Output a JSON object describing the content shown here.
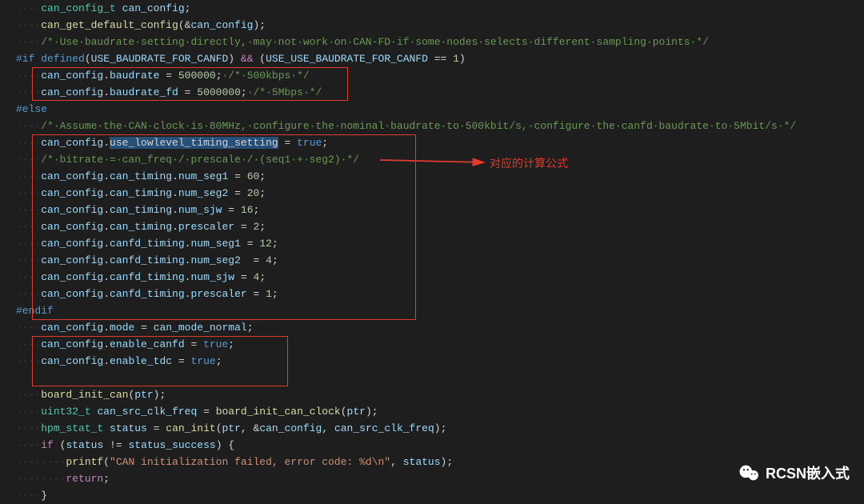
{
  "watermark": {
    "text": "RCSN嵌入式"
  },
  "annotation": {
    "label": "对应的计算公式"
  },
  "chart_data": {
    "type": "table",
    "title": "CAN config snippet (C source)",
    "rows": [
      [
        "can_config_t can_config;"
      ],
      [
        "can_get_default_config(&can_config);"
      ],
      [
        "/* Use baudrate setting directly, may not work on CAN-FD if some nodes selects different sampling points */"
      ],
      [
        "#if defined(USE_BAUDRATE_FOR_CANFD) && (USE_USE_BAUDRATE_FOR_CANFD == 1)"
      ],
      [
        "can_config.baudrate = 500000; /* 500kbps */"
      ],
      [
        "can_config.baudrate_fd = 5000000; /* 5Mbps */"
      ],
      [
        "#else"
      ],
      [
        "/* Assume the CAN clock is 80MHz, configure the nominal baudrate to 500kbit/s, configure the canfd baudrate to 5Mbit/s */"
      ],
      [
        "can_config.use_lowlevel_timing_setting = true;"
      ],
      [
        "/* bitrate = can_freq / prescale / (seq1 + seg2) */"
      ],
      [
        "can_config.can_timing.num_seg1 = 60;"
      ],
      [
        "can_config.can_timing.num_seg2 = 20;"
      ],
      [
        "can_config.can_timing.num_sjw = 16;"
      ],
      [
        "can_config.can_timing.prescaler = 2;"
      ],
      [
        "can_config.canfd_timing.num_seg1 = 12;"
      ],
      [
        "can_config.canfd_timing.num_seg2  = 4;"
      ],
      [
        "can_config.canfd_timing.num_sjw = 4;"
      ],
      [
        "can_config.canfd_timing.prescaler = 1;"
      ],
      [
        "#endif"
      ],
      [
        "can_config.mode = can_mode_normal;"
      ],
      [
        "can_config.enable_canfd = true;"
      ],
      [
        "can_config.enable_tdc = true;"
      ],
      [
        ""
      ],
      [
        "board_init_can(ptr);"
      ],
      [
        "uint32_t can_src_clk_freq = board_init_can_clock(ptr);"
      ],
      [
        "hpm_stat_t status = can_init(ptr, &can_config, can_src_clk_freq);"
      ],
      [
        "if (status != status_success) {"
      ],
      [
        "    printf(\"CAN initialization failed, error code: %d\\n\", status);"
      ],
      [
        "    return;"
      ],
      [
        "}"
      ]
    ]
  },
  "tokens": {
    "l0": [
      [
        "ws",
        "····"
      ],
      [
        "ty",
        "can_config_t"
      ],
      [
        "op",
        " "
      ],
      [
        "id",
        "can_config"
      ],
      [
        "op",
        ";"
      ]
    ],
    "l1": [
      [
        "ws",
        "····"
      ],
      [
        "fn",
        "can_get_default_config"
      ],
      [
        "op",
        "(&"
      ],
      [
        "id",
        "can_config"
      ],
      [
        "op",
        ");"
      ]
    ],
    "l2": [
      [
        "ws",
        "····"
      ],
      [
        "cm",
        "/*·Use·baudrate·setting·directly,·may·not·work·on·CAN-FD·if·some·nodes·selects·different·sampling·points·*/"
      ]
    ],
    "l3": [
      [
        "macro",
        "#if"
      ],
      [
        "op",
        " "
      ],
      [
        "macro",
        "defined"
      ],
      [
        "op",
        "("
      ],
      [
        "id",
        "USE_BAUDRATE_FOR_CANFD"
      ],
      [
        "op",
        ") "
      ],
      [
        "kw",
        "&&"
      ],
      [
        "op",
        " ("
      ],
      [
        "id",
        "USE_USE_BAUDRATE_FOR_CANFD"
      ],
      [
        "op",
        " == "
      ],
      [
        "num",
        "1"
      ],
      [
        "op",
        ")"
      ]
    ],
    "l4": [
      [
        "ws",
        "····"
      ],
      [
        "id",
        "can_config"
      ],
      [
        "op",
        "."
      ],
      [
        "id",
        "baudrate"
      ],
      [
        "op",
        " = "
      ],
      [
        "num",
        "500000"
      ],
      [
        "op",
        ";"
      ],
      [
        "cm",
        "·/*·500kbps·*/"
      ]
    ],
    "l5": [
      [
        "ws",
        "····"
      ],
      [
        "id",
        "can_config"
      ],
      [
        "op",
        "."
      ],
      [
        "id",
        "baudrate_fd"
      ],
      [
        "op",
        " = "
      ],
      [
        "num",
        "5000000"
      ],
      [
        "op",
        ";"
      ],
      [
        "cm",
        "·/*·5Mbps·*/"
      ]
    ],
    "l6": [
      [
        "macro",
        "#else"
      ]
    ],
    "l7": [
      [
        "ws",
        "····"
      ],
      [
        "cm",
        "/*·Assume·the·CAN·clock·is·80MHz,·configure·the·nominal·baudrate·to·500kbit/s,·configure·the·canfd·baudrate·to·5Mbit/s·*/"
      ]
    ],
    "l8": [
      [
        "ws",
        "····"
      ],
      [
        "id",
        "can_config"
      ],
      [
        "op",
        "."
      ],
      [
        "hilite",
        "use_lowlevel_timing_setting"
      ],
      [
        "op",
        " = "
      ],
      [
        "bool",
        "true"
      ],
      [
        "op",
        ";"
      ]
    ],
    "l9": [
      [
        "ws",
        "····"
      ],
      [
        "cm",
        "/*·bitrate·=·can_freq·/·prescale·/·(seq1·+·seg2)·*/"
      ]
    ],
    "l10": [
      [
        "ws",
        "····"
      ],
      [
        "id",
        "can_config"
      ],
      [
        "op",
        "."
      ],
      [
        "id",
        "can_timing"
      ],
      [
        "op",
        "."
      ],
      [
        "id",
        "num_seg1"
      ],
      [
        "op",
        " = "
      ],
      [
        "num",
        "60"
      ],
      [
        "op",
        ";"
      ]
    ],
    "l11": [
      [
        "ws",
        "····"
      ],
      [
        "id",
        "can_config"
      ],
      [
        "op",
        "."
      ],
      [
        "id",
        "can_timing"
      ],
      [
        "op",
        "."
      ],
      [
        "id",
        "num_seg2"
      ],
      [
        "op",
        " = "
      ],
      [
        "num",
        "20"
      ],
      [
        "op",
        ";"
      ]
    ],
    "l12": [
      [
        "ws",
        "····"
      ],
      [
        "id",
        "can_config"
      ],
      [
        "op",
        "."
      ],
      [
        "id",
        "can_timing"
      ],
      [
        "op",
        "."
      ],
      [
        "id",
        "num_sjw"
      ],
      [
        "op",
        " = "
      ],
      [
        "num",
        "16"
      ],
      [
        "op",
        ";"
      ]
    ],
    "l13": [
      [
        "ws",
        "····"
      ],
      [
        "id",
        "can_config"
      ],
      [
        "op",
        "."
      ],
      [
        "id",
        "can_timing"
      ],
      [
        "op",
        "."
      ],
      [
        "id",
        "prescaler"
      ],
      [
        "op",
        " = "
      ],
      [
        "num",
        "2"
      ],
      [
        "op",
        ";"
      ]
    ],
    "l14": [
      [
        "ws",
        "····"
      ],
      [
        "id",
        "can_config"
      ],
      [
        "op",
        "."
      ],
      [
        "id",
        "canfd_timing"
      ],
      [
        "op",
        "."
      ],
      [
        "id",
        "num_seg1"
      ],
      [
        "op",
        " = "
      ],
      [
        "num",
        "12"
      ],
      [
        "op",
        ";"
      ]
    ],
    "l15": [
      [
        "ws",
        "····"
      ],
      [
        "id",
        "can_config"
      ],
      [
        "op",
        "."
      ],
      [
        "id",
        "canfd_timing"
      ],
      [
        "op",
        "."
      ],
      [
        "id",
        "num_seg2"
      ],
      [
        "op",
        "  = "
      ],
      [
        "num",
        "4"
      ],
      [
        "op",
        ";"
      ]
    ],
    "l16": [
      [
        "ws",
        "····"
      ],
      [
        "id",
        "can_config"
      ],
      [
        "op",
        "."
      ],
      [
        "id",
        "canfd_timing"
      ],
      [
        "op",
        "."
      ],
      [
        "id",
        "num_sjw"
      ],
      [
        "op",
        " = "
      ],
      [
        "num",
        "4"
      ],
      [
        "op",
        ";"
      ]
    ],
    "l17": [
      [
        "ws",
        "····"
      ],
      [
        "id",
        "can_config"
      ],
      [
        "op",
        "."
      ],
      [
        "id",
        "canfd_timing"
      ],
      [
        "op",
        "."
      ],
      [
        "id",
        "prescaler"
      ],
      [
        "op",
        " = "
      ],
      [
        "num",
        "1"
      ],
      [
        "op",
        ";"
      ]
    ],
    "l18": [
      [
        "macro",
        "#endif"
      ]
    ],
    "l19": [
      [
        "ws",
        "····"
      ],
      [
        "id",
        "can_config"
      ],
      [
        "op",
        "."
      ],
      [
        "id",
        "mode"
      ],
      [
        "op",
        " = "
      ],
      [
        "id",
        "can_mode_normal"
      ],
      [
        "op",
        ";"
      ]
    ],
    "l20": [
      [
        "ws",
        "····"
      ],
      [
        "id",
        "can_config"
      ],
      [
        "op",
        "."
      ],
      [
        "id",
        "enable_canfd"
      ],
      [
        "op",
        " = "
      ],
      [
        "bool",
        "true"
      ],
      [
        "op",
        ";"
      ]
    ],
    "l21": [
      [
        "ws",
        "····"
      ],
      [
        "id",
        "can_config"
      ],
      [
        "op",
        "."
      ],
      [
        "id",
        "enable_tdc"
      ],
      [
        "op",
        " = "
      ],
      [
        "bool",
        "true"
      ],
      [
        "op",
        ";"
      ]
    ],
    "l22": [
      [
        "op",
        ""
      ]
    ],
    "l23": [
      [
        "ws",
        "····"
      ],
      [
        "fn",
        "board_init_can"
      ],
      [
        "op",
        "("
      ],
      [
        "id",
        "ptr"
      ],
      [
        "op",
        ");"
      ]
    ],
    "l24": [
      [
        "ws",
        "····"
      ],
      [
        "ty",
        "uint32_t"
      ],
      [
        "op",
        " "
      ],
      [
        "id",
        "can_src_clk_freq"
      ],
      [
        "op",
        " = "
      ],
      [
        "fn",
        "board_init_can_clock"
      ],
      [
        "op",
        "("
      ],
      [
        "id",
        "ptr"
      ],
      [
        "op",
        ");"
      ]
    ],
    "l25": [
      [
        "ws",
        "····"
      ],
      [
        "ty",
        "hpm_stat_t"
      ],
      [
        "op",
        " "
      ],
      [
        "id",
        "status"
      ],
      [
        "op",
        " = "
      ],
      [
        "fn",
        "can_init"
      ],
      [
        "op",
        "("
      ],
      [
        "id",
        "ptr"
      ],
      [
        "op",
        ", &"
      ],
      [
        "id",
        "can_config"
      ],
      [
        "op",
        ", "
      ],
      [
        "id",
        "can_src_clk_freq"
      ],
      [
        "op",
        ");"
      ]
    ],
    "l26": [
      [
        "ws",
        "····"
      ],
      [
        "kw",
        "if"
      ],
      [
        "op",
        " ("
      ],
      [
        "id",
        "status"
      ],
      [
        "op",
        " != "
      ],
      [
        "id",
        "status_success"
      ],
      [
        "op",
        ") {"
      ]
    ],
    "l27": [
      [
        "ws",
        "········"
      ],
      [
        "fn",
        "printf"
      ],
      [
        "op",
        "("
      ],
      [
        "str",
        "\"CAN initialization failed, error code: %d\\n\""
      ],
      [
        "op",
        ", "
      ],
      [
        "id",
        "status"
      ],
      [
        "op",
        ");"
      ]
    ],
    "l28": [
      [
        "ws",
        "········"
      ],
      [
        "kw",
        "return"
      ],
      [
        "op",
        ";"
      ]
    ],
    "l29": [
      [
        "ws",
        "····"
      ],
      [
        "op",
        "}"
      ]
    ]
  }
}
